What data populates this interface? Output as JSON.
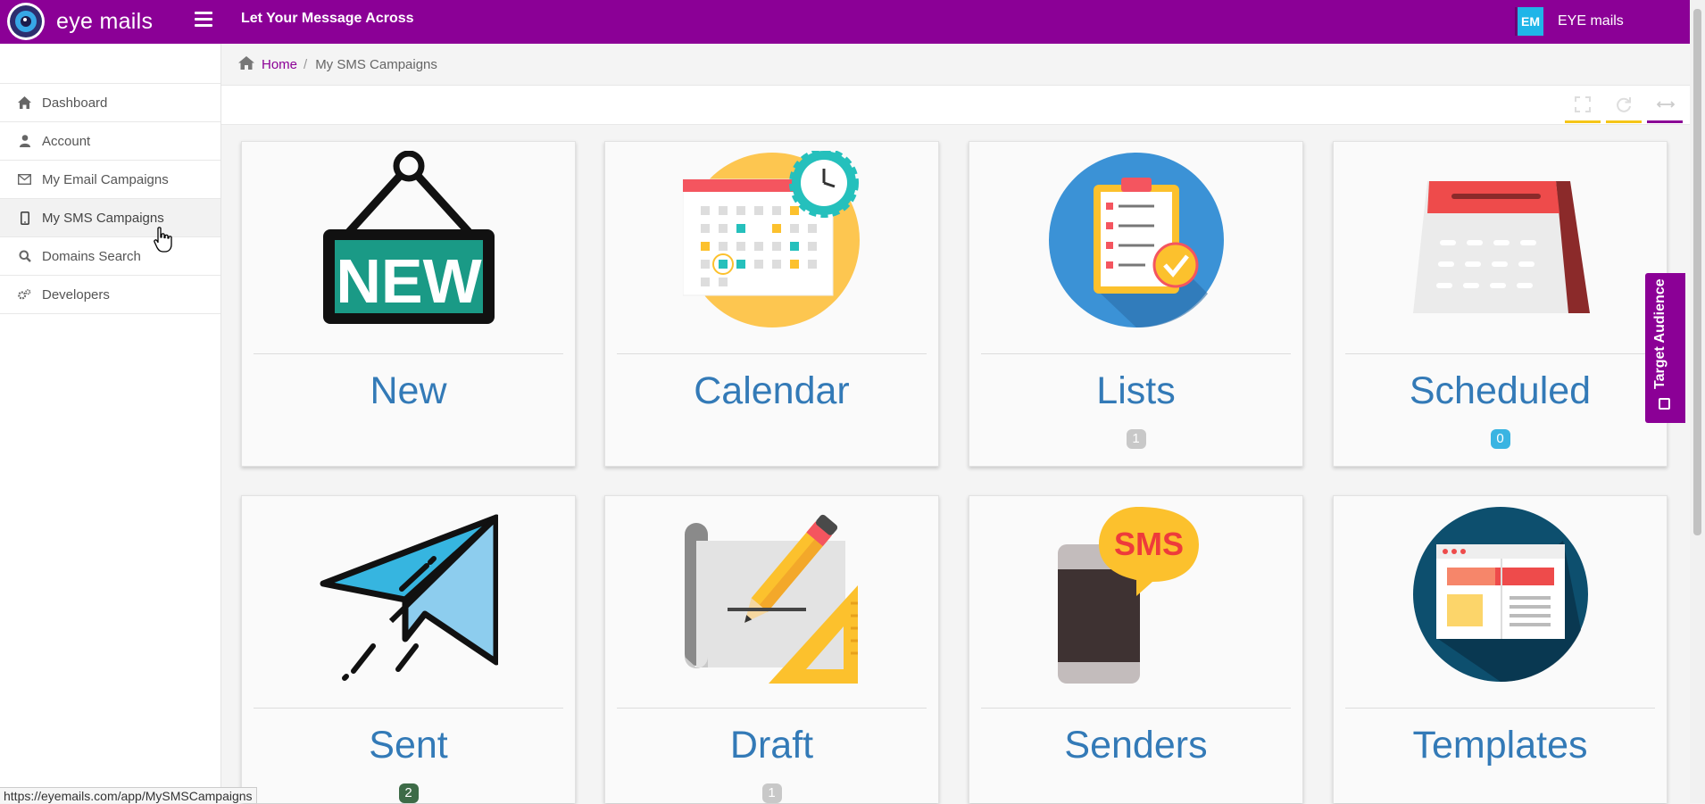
{
  "header": {
    "brand": "eye mails",
    "tagline": "Let Your Message Across",
    "user_initials": "EM",
    "user_name": "EYE mails",
    "bar_color": "#8b0096"
  },
  "sidebar": {
    "items": [
      {
        "label": "Dashboard",
        "icon": "home-icon"
      },
      {
        "label": "Account",
        "icon": "user-icon"
      },
      {
        "label": "My Email Campaigns",
        "icon": "envelope-icon"
      },
      {
        "label": "My SMS Campaigns",
        "icon": "mobile-icon",
        "active": true
      },
      {
        "label": "Domains Search",
        "icon": "search-icon"
      },
      {
        "label": "Developers",
        "icon": "cogs-icon"
      }
    ]
  },
  "breadcrumb": {
    "home": "Home",
    "separator": "/",
    "current": "My SMS Campaigns"
  },
  "widget_tools": [
    {
      "icon": "expand-icon",
      "color": "#f5c518"
    },
    {
      "icon": "refresh-icon",
      "color": "#f5c518"
    },
    {
      "icon": "collapse-icon",
      "color": "#8b0096"
    }
  ],
  "cards": [
    {
      "label": "New",
      "icon": "new-sign-icon"
    },
    {
      "label": "Calendar",
      "icon": "calendar-icon"
    },
    {
      "label": "Lists",
      "icon": "clipboard-list-icon",
      "badge": "1",
      "badge_color": "#c8c8c8"
    },
    {
      "label": "Scheduled",
      "icon": "desk-calendar-icon",
      "badge": "0",
      "badge_color": "#3ab4e2"
    },
    {
      "label": "Sent",
      "icon": "paper-plane-icon",
      "badge": "2",
      "badge_color": "#3d6b47"
    },
    {
      "label": "Draft",
      "icon": "pencil-ruler-icon",
      "badge": "1",
      "badge_color": "#c8c8c8"
    },
    {
      "label": "Senders",
      "icon": "sms-phone-icon"
    },
    {
      "label": "Templates",
      "icon": "web-template-icon"
    }
  ],
  "target_tab": {
    "label": "Target Audience"
  },
  "status_url": "https://eyemails.com/app/MySMSCampaigns"
}
